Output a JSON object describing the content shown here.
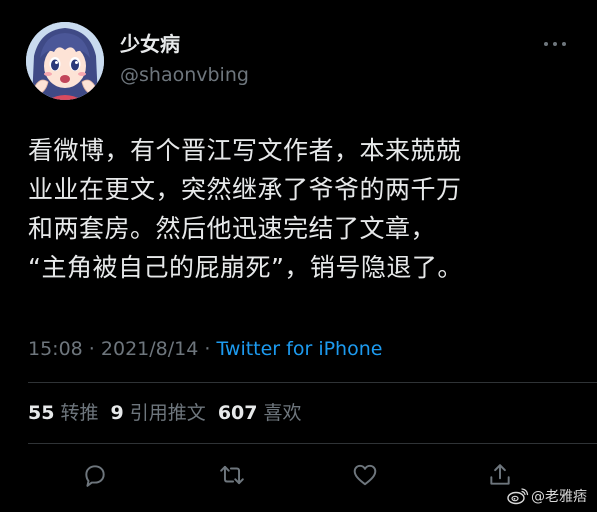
{
  "tweet": {
    "author": {
      "display_name": "少女病",
      "handle": "@shaonvbing",
      "avatar_icon": "anime-avatar-icon"
    },
    "more_icon": "more-horizontal-icon",
    "text": "看微博，有个晋江写文作者，本来兢兢\n业业在更文，突然继承了爷爷的两千万\n和两套房。然后他迅速完结了文章，\n“主角被自己的屁崩死”，销号隐退了。",
    "meta": {
      "time": "15:08",
      "sep1": " · ",
      "date": "2021/8/14",
      "sep2": " · ",
      "client": "Twitter for iPhone"
    },
    "stats": {
      "retweets_count": "55",
      "retweets_label": "转推",
      "quotes_count": "9",
      "quotes_label": "引用推文",
      "likes_count": "607",
      "likes_label": "喜欢"
    },
    "actions": {
      "reply_icon": "reply-icon",
      "retweet_icon": "retweet-icon",
      "like_icon": "heart-icon",
      "share_icon": "share-icon"
    }
  },
  "watermark": {
    "text": "@老雅痞",
    "icon": "weibo-logo-icon"
  },
  "colors": {
    "background": "#000000",
    "text_primary": "#e7e9ea",
    "text_secondary": "#6e767d",
    "link": "#1d9bf0",
    "divider": "#2f3336"
  }
}
